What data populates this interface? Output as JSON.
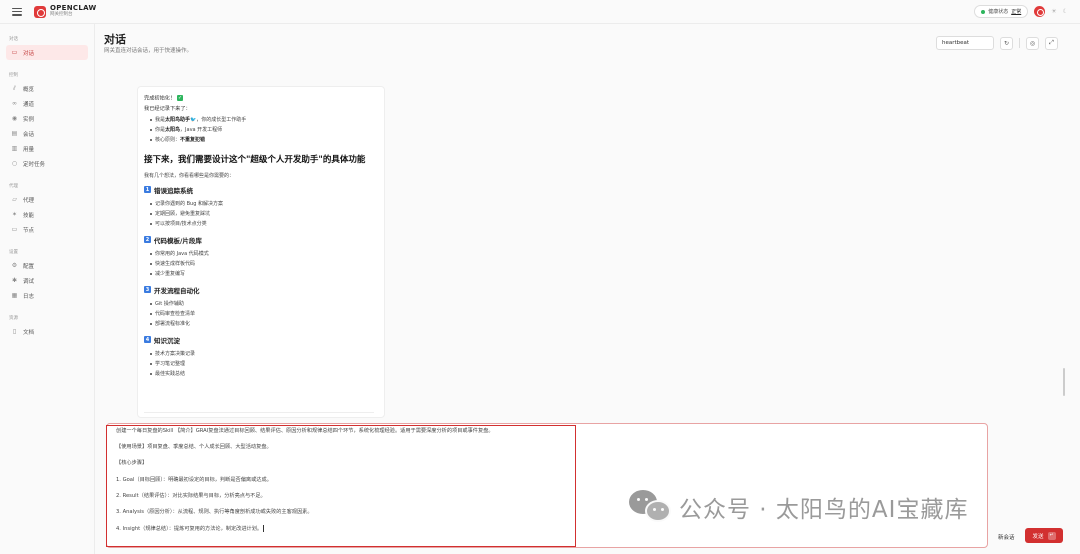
{
  "app": {
    "name": "OPENCLAW",
    "subtitle": "网关控制台"
  },
  "topbar": {
    "health_label": "健康状态",
    "health_value": "正常"
  },
  "sidebar": {
    "groups": [
      {
        "label": "对话",
        "items": [
          {
            "label": "对话",
            "icon": "chat-icon",
            "active": true
          }
        ]
      },
      {
        "label": "控制",
        "items": [
          {
            "label": "概览",
            "icon": "chart-icon"
          },
          {
            "label": "通道",
            "icon": "link-icon"
          },
          {
            "label": "实例",
            "icon": "radio-icon"
          },
          {
            "label": "会话",
            "icon": "file-icon"
          },
          {
            "label": "用量",
            "icon": "bar-icon"
          },
          {
            "label": "定时任务",
            "icon": "clock-icon"
          }
        ]
      },
      {
        "label": "代理",
        "items": [
          {
            "label": "代理",
            "icon": "folder-icon"
          },
          {
            "label": "技能",
            "icon": "spark-icon"
          },
          {
            "label": "节点",
            "icon": "monitor-icon"
          }
        ]
      },
      {
        "label": "设置",
        "items": [
          {
            "label": "配置",
            "icon": "gear-icon"
          },
          {
            "label": "调试",
            "icon": "bug-icon"
          },
          {
            "label": "日志",
            "icon": "log-icon"
          }
        ]
      },
      {
        "label": "资源",
        "items": [
          {
            "label": "文档",
            "icon": "book-icon"
          }
        ]
      }
    ]
  },
  "header": {
    "title": "对话",
    "subtitle": "网关直连对话会话，用于快速操作。",
    "session_key": "heartbeat"
  },
  "chat": {
    "line1": "完成初始化！",
    "line2": "我已经记录下来了：",
    "facts": [
      {
        "pre": "我是",
        "bold": "太阳鸟助手",
        "post": "🐦，你的成长型工作助手"
      },
      {
        "pre": "你是",
        "bold": "太阳鸟",
        "post": "，Java 开发工程师"
      },
      {
        "pre": "核心原则：",
        "bold": "不重复犯错",
        "post": ""
      }
    ],
    "heading": "接下来，我们需要设计这个\"超级个人开发助手\"的具体功能",
    "intro": "我有几个想法，你看看哪些是你需要的：",
    "sections": [
      {
        "num": "1",
        "title": "错误追踪系统",
        "items": [
          "记录你遇到的 Bug 和解决方案",
          "定期回顾，避免重复踩坑",
          "可以按项目/技术点分类"
        ]
      },
      {
        "num": "2",
        "title": "代码模板/片段库",
        "items": [
          "你常用的 Java 代码模式",
          "快速生成样板代码",
          "减少重复编写"
        ]
      },
      {
        "num": "3",
        "title": "开发流程自动化",
        "items": [
          "Git 操作辅助",
          "代码审查检查清单",
          "部署流程标准化"
        ]
      },
      {
        "num": "4",
        "title": "知识沉淀",
        "items": [
          "技术方案决策记录",
          "学习笔记整理",
          "最佳实践总结"
        ]
      }
    ]
  },
  "composer": {
    "lines": [
      "创建一个每日复盘的Skill 【简介】GRAI复盘法通过目标回顾、结果评估、原因分析和规律总结四个环节，系统化梳理经验。适用于需要深度分析的项目或事件复盘。",
      "【使用场景】项目复盘、季度总结、个人成长回顾、大型活动复盘。",
      "【核心步骤】",
      "1. Goal（目标回顾）：明确最初设定的目标，判断是否偏离或达成。",
      "2. Result（结果评估）：对比实际结果与目标，分析亮点与不足。",
      "3. Analysis（原因分析）：从流程、规则、执行等角度剖析成功或失败的主客观因素。",
      "4. Insight（规律总结）：提炼可复用的方法论，制定改进计划。"
    ],
    "new_session": "新会话",
    "send": "发送",
    "send_shortcut": "↵"
  },
  "watermark": {
    "text": "公众号 · 太阳鸟的AI宝藏库"
  },
  "colors": {
    "accent": "#d23030",
    "active_bg": "#fde8e8",
    "ok": "#2db55d"
  }
}
